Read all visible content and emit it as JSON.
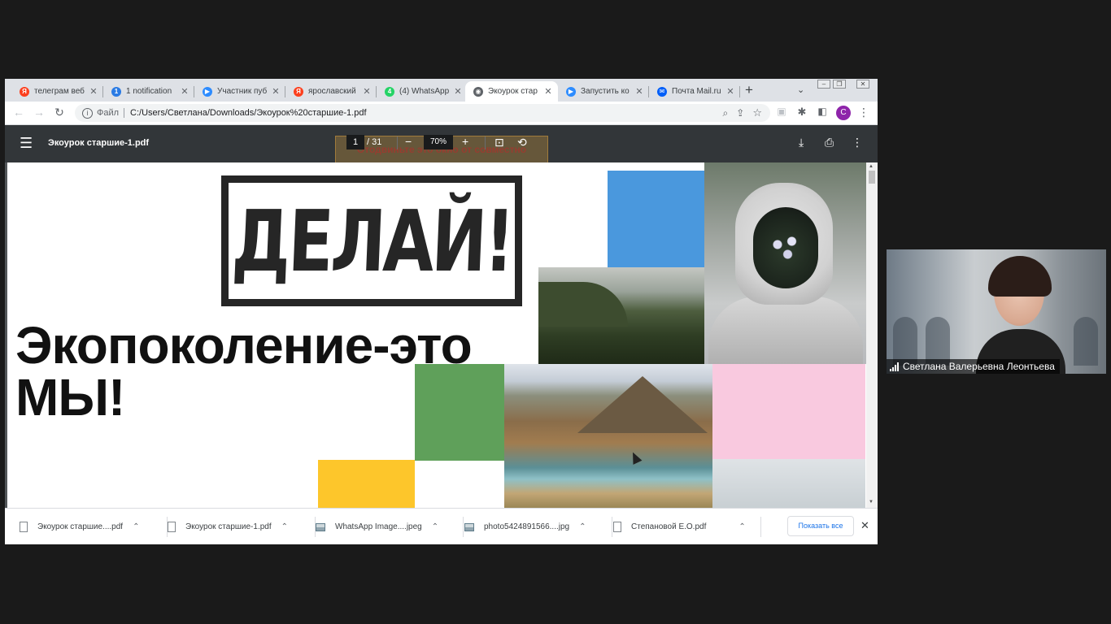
{
  "tabs": [
    {
      "title": "телеграм веб",
      "favicon_color": "#fc3f1d",
      "favicon_glyph": "Я"
    },
    {
      "title": "1 notification",
      "favicon_color": "#2a7be4",
      "favicon_glyph": "1"
    },
    {
      "title": "Участник пуб",
      "favicon_color": "#2d8cff",
      "favicon_glyph": "▶"
    },
    {
      "title": "ярославский",
      "favicon_color": "#fc3f1d",
      "favicon_glyph": "Я"
    },
    {
      "title": "(4) WhatsApp",
      "favicon_color": "#25d366",
      "favicon_glyph": "4"
    },
    {
      "title": "Экоурок стар",
      "favicon_color": "#5f6368",
      "favicon_glyph": "◉",
      "active": true
    },
    {
      "title": "Запустить ко",
      "favicon_color": "#2d8cff",
      "favicon_glyph": "▶"
    },
    {
      "title": "Почта Mail.ru",
      "favicon_color": "#005ff9",
      "favicon_glyph": "✉"
    }
  ],
  "omnibox": {
    "scheme_label": "Файл",
    "url": "C:/Users/Светлана/Downloads/Экоурок%20старшие-1.pdf"
  },
  "profile_initial": "C",
  "pdf": {
    "filename": "Экоурок старшие-1.pdf",
    "current_page": "1",
    "page_total": "/ 31",
    "zoom": "70%",
    "share_banner": "Отодвиньте это окно от совместно"
  },
  "slide": {
    "logo_text": "ДЕЛАЙ!",
    "headline_line1": "Экопоколение-это",
    "headline_line2": "МЫ!",
    "colors": {
      "blue": "#4a98dd",
      "green": "#5fa05a",
      "yellow": "#fdc62b",
      "pink": "#f9c9df"
    }
  },
  "downloads": [
    {
      "name": "Экоурок старшие....pdf",
      "type": "pdf"
    },
    {
      "name": "Экоурок старшие-1.pdf",
      "type": "pdf"
    },
    {
      "name": "WhatsApp Image....jpeg",
      "type": "image"
    },
    {
      "name": "photo5424891566....jpg",
      "type": "image"
    },
    {
      "name": "Степановой Е.О.pdf",
      "type": "pdf"
    }
  ],
  "downloads_show_all": "Показать все",
  "video": {
    "participant_name": "Светлана Валерьевна Леонтьева"
  }
}
